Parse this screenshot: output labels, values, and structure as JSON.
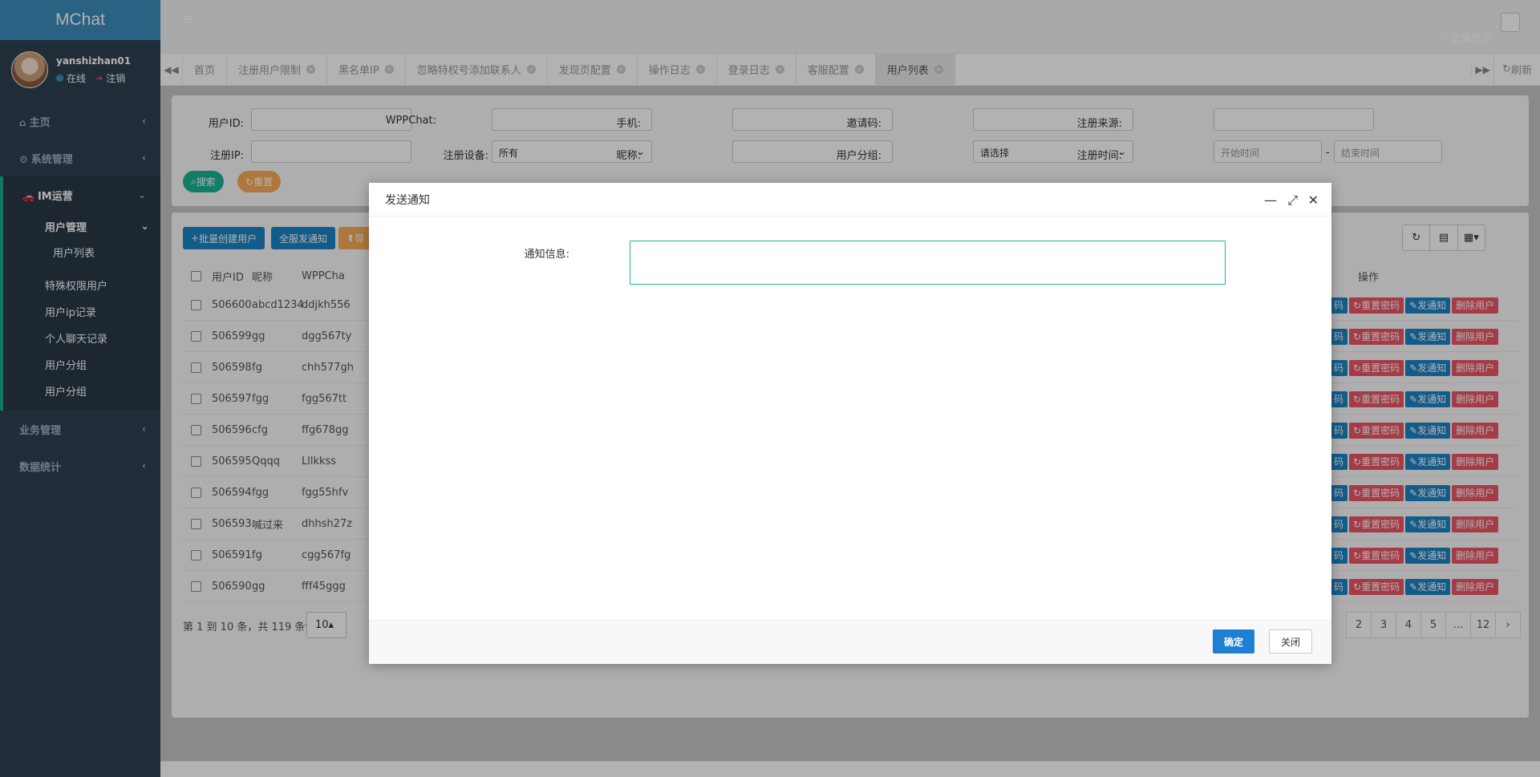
{
  "app": {
    "title": "MChat"
  },
  "user": {
    "name": "yanshizhan01",
    "status": "在线",
    "logout": "注销"
  },
  "sidebar": {
    "items": [
      {
        "label": "主页",
        "icon": "home-icon"
      },
      {
        "label": "系统管理",
        "icon": "gear-icon"
      },
      {
        "label": "IM运营",
        "icon": "car-icon"
      },
      {
        "label": "业务管理",
        "icon": ""
      },
      {
        "label": "数据统计",
        "icon": ""
      }
    ],
    "im_sub": {
      "group": "用户管理",
      "group_items": [
        "用户列表"
      ],
      "items": [
        "特殊权限用户",
        "用户ip记录",
        "个人聊天记录",
        "用户分组",
        "用户分组"
      ]
    }
  },
  "header": {
    "fullscreen": "全屏显示",
    "refresh": "刷新"
  },
  "tabs": [
    "首页",
    "注册用户限制",
    "黑名单IP",
    "忽略特权号添加联系人",
    "发现页配置",
    "操作日志",
    "登录日志",
    "客服配置",
    "用户列表"
  ],
  "search": {
    "user_id": "用户ID:",
    "wppchat": "WPPChat:",
    "phone": "手机:",
    "invite": "邀请码:",
    "source": "注册来源:",
    "reg_ip": "注册IP:",
    "device": "注册设备:",
    "device_value": "所有",
    "nickname": "昵称:",
    "group": "用户分组:",
    "group_value": "请选择",
    "reg_time": "注册时间:",
    "start_time": "开始时间",
    "dash": "-",
    "end_time": "结束时间",
    "search_btn": "搜索",
    "reset_btn": "重置"
  },
  "toolbar": {
    "batch_create": "批量创建用户",
    "notify_all": "全服发通知",
    "export": "导"
  },
  "table": {
    "headers": {
      "id": "用户ID",
      "nick": "昵称",
      "wpp": "WPPCha",
      "ops": "操作"
    },
    "rows": [
      {
        "id": "506600",
        "nick": "abcd1234",
        "wpp": "ddjkh556"
      },
      {
        "id": "506599",
        "nick": "gg",
        "wpp": "dgg567ty"
      },
      {
        "id": "506598",
        "nick": "fg",
        "wpp": "chh577gh"
      },
      {
        "id": "506597",
        "nick": "fgg",
        "wpp": "fgg567tt"
      },
      {
        "id": "506596",
        "nick": "cfg",
        "wpp": "ffg678gg"
      },
      {
        "id": "506595",
        "nick": "Qqqq",
        "wpp": "Lllkkss"
      },
      {
        "id": "506594",
        "nick": "fgg",
        "wpp": "fgg55hfv"
      },
      {
        "id": "506593",
        "nick": "喊过来",
        "wpp": "dhhsh27z"
      },
      {
        "id": "506591",
        "nick": "fg",
        "wpp": "cgg567fg"
      },
      {
        "id": "506590",
        "nick": "gg",
        "wpp": "fff45ggg"
      }
    ],
    "actions": {
      "first": "码",
      "reset_pwd": "重置密码",
      "notify": "发通知",
      "delete": "删除用户"
    }
  },
  "pagination": {
    "summary": "第 1 到 10 条，共 119 条记录。",
    "page_size": "10",
    "pages": [
      "2",
      "3",
      "4",
      "5",
      "...",
      "12",
      "›"
    ]
  },
  "modal": {
    "title": "发送通知",
    "label": "通知信息:",
    "ok": "确定",
    "close": "关闭"
  },
  "colors": {
    "sidebar": "#2f4050",
    "brand": "#3c8dbc",
    "accent": "#1ab394",
    "danger": "#ed5565",
    "primary": "#1c84c6"
  }
}
